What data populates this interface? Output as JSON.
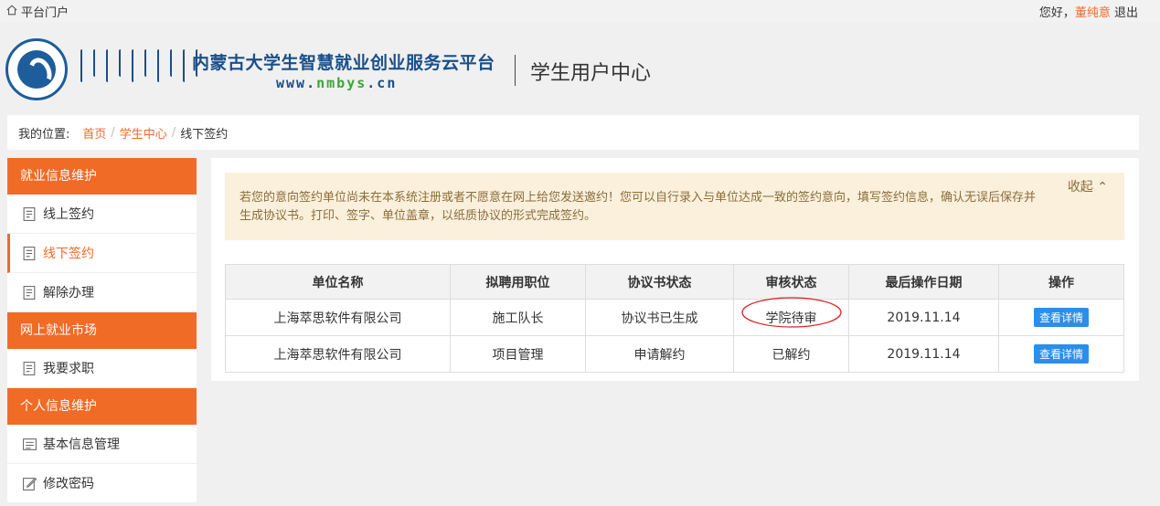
{
  "topbar": {
    "portal_label": "平台门户",
    "greeting": "您好，",
    "user_name": "董纯意",
    "logout": "退出"
  },
  "header": {
    "brand_cn": "内蒙古大学生智慧就业创业服务云平台",
    "url_prefix": "www.",
    "url_mid": "nmbys",
    "url_suffix": ".cn",
    "center_title": "学生用户中心"
  },
  "breadcrumb": {
    "lead": "我的位置:",
    "home": "首页",
    "student": "学生中心",
    "sep": "/",
    "current": "线下签约"
  },
  "sidebar": {
    "sec1": "就业信息维护",
    "online_sign": "线上签约",
    "offline_sign": "线下签约",
    "cancel": "解除办理",
    "sec2": "网上就业市场",
    "job_seek": "我要求职",
    "sec3": "个人信息维护",
    "basic_info": "基本信息管理",
    "change_pwd": "修改密码"
  },
  "notice": {
    "text": "若您的意向签约单位尚未在本系统注册或者不愿意在网上给您发送邀约！您可以自行录入与单位达成一致的签约意向，填写签约信息，确认无误后保存并生成协议书。打印、签字、单位盖章，以纸质协议的形式完成签约。",
    "collapse_label": "收起"
  },
  "table": {
    "headers": [
      "单位名称",
      "拟聘用职位",
      "协议书状态",
      "审核状态",
      "最后操作日期",
      "操作"
    ],
    "rows": [
      {
        "company": "上海萃思软件有限公司",
        "position": "施工队长",
        "agreement": "协议书已生成",
        "review": "学院待审",
        "date": "2019.11.14",
        "action": "查看详情"
      },
      {
        "company": "上海萃思软件有限公司",
        "position": "项目管理",
        "agreement": "申请解约",
        "review": "已解约",
        "date": "2019.11.14",
        "action": "查看详情"
      }
    ]
  },
  "colors": {
    "accent": "#f06b26",
    "brand_blue": "#1a4f8a",
    "success": "#2a9d2a",
    "button": "#2b8ee8",
    "annotation": "#e02020"
  },
  "icons": [
    "home-icon",
    "document-icon",
    "id-card-icon",
    "edit-icon",
    "chevron-up-icon",
    "logo-icon"
  ]
}
